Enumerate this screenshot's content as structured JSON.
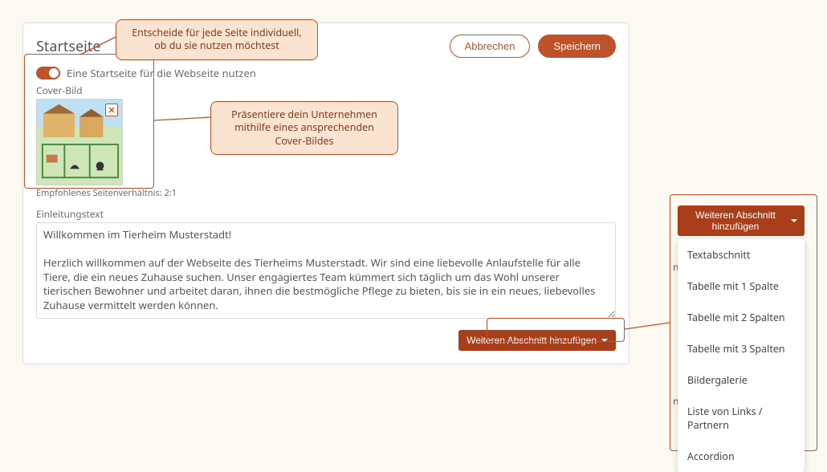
{
  "header": {
    "title": "Startseite",
    "cancel": "Abbrechen",
    "save": "Speichern"
  },
  "toggle": {
    "label": "Eine Startseite für die Webseite nutzen"
  },
  "cover": {
    "section_label": "Cover-Bild",
    "hint": "Empfohlenes Seitenverhältnis: 2:1"
  },
  "intro": {
    "section_label": "Einleitungstext",
    "value": "Willkommen im Tierheim Musterstadt!\n\nHerzlich willkommen auf der Webseite des Tierheims Musterstadt. Wir sind eine liebevolle Anlaufstelle für alle Tiere, die ein neues Zuhause suchen. Unser engagiertes Team kümmert sich täglich um das Wohl unserer tierischen Bewohner und arbeitet daran, ihnen die bestmögliche Pflege zu bieten, bis sie in ein neues, liebevolles Zuhause vermittelt werden können.\n\nEgal ob Sie ein Haustier adoptieren, sich über unsere Arbeit informieren oder uns unterstützen möchten – hier sind Sie genau richtig!"
  },
  "addSection": {
    "label": "Weiteren Abschnitt hinzufügen"
  },
  "callouts": {
    "c1": "Entscheide für jede Seite individuell, ob du sie nutzen möchtest",
    "c2": "Präsentiere dein Unternehmen mithilfe eines ansprechenden Cover-Bildes"
  },
  "menu": {
    "items": [
      "Textabschnitt",
      "Tabelle mit 1 Spalte",
      "Tabelle mit 2 Spalten",
      "Tabelle mit 3 Spalten",
      "Bildergalerie",
      "Liste von Links / Partnern",
      "Accordion"
    ]
  },
  "decoration": {
    "edge1": "n",
    "edge2": "n"
  }
}
